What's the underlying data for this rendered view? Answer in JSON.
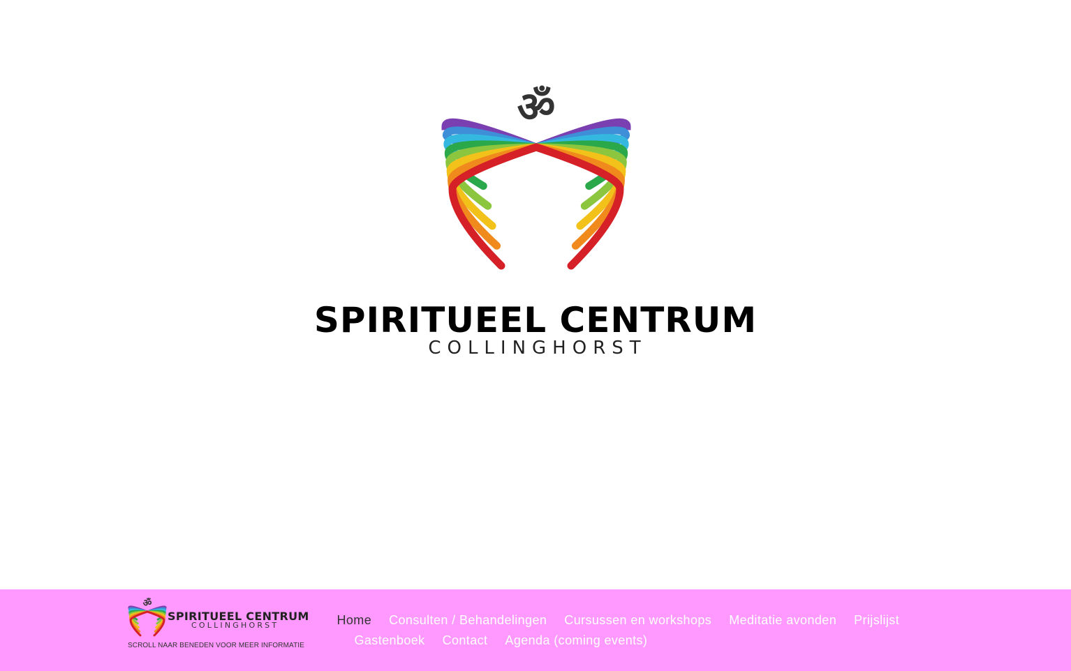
{
  "hero": {
    "logo_icon": "om-wings-logo",
    "title": "SPIRITUEEL CENTRUM",
    "subtitle": "COLLINGHORST"
  },
  "navbar": {
    "background": "#ff99ff",
    "logo": {
      "title": "SPIRITUEEL CENTRUM",
      "subtitle": "COLLINGHORST"
    },
    "tagline": "SCROLL NAAR BENEDEN VOOR MEER INFORMATIE",
    "menu_row1": [
      "Home",
      "Consulten / Behandelingen",
      "Cursussen en workshops",
      "Meditatie avonden",
      "Prijslijst"
    ],
    "menu_row2": [
      "Gastenboek",
      "Contact",
      "Agenda (coming events)"
    ],
    "active_item": "Home"
  },
  "colors": {
    "active_text": "#333333",
    "menu_text": "#ffffff",
    "rainbow": [
      "#7a3fb0",
      "#3f8fd8",
      "#35b8e0",
      "#2aa84a",
      "#8cc63f",
      "#f2c21b",
      "#f08a1d",
      "#d62027"
    ]
  }
}
